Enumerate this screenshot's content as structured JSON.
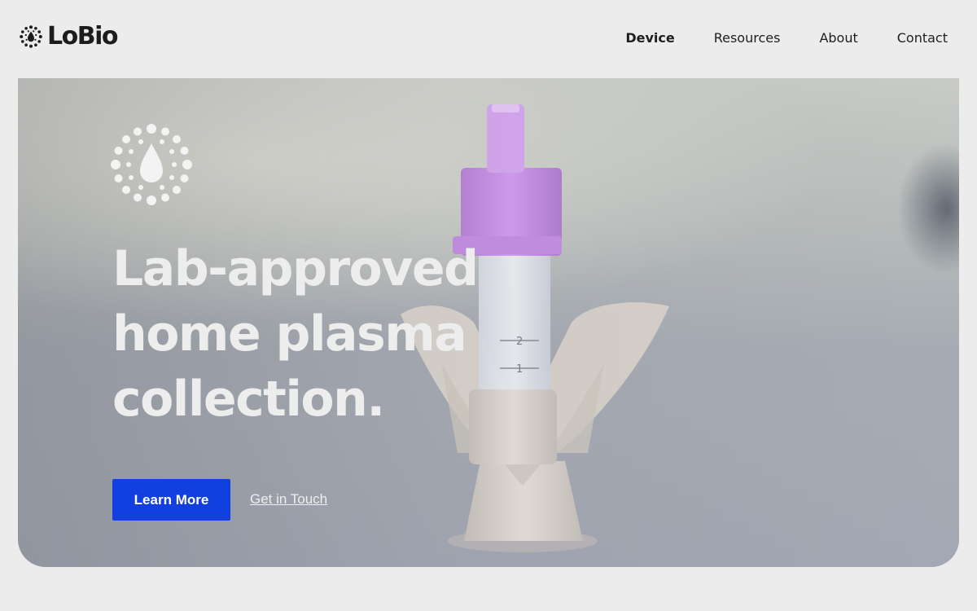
{
  "header": {
    "brand": "LoBio",
    "nav": [
      {
        "label": "Device",
        "active": true
      },
      {
        "label": "Resources",
        "active": false
      },
      {
        "label": "About",
        "active": false
      },
      {
        "label": "Contact",
        "active": false
      }
    ]
  },
  "hero": {
    "headline": [
      "Lab-approved",
      "home plasma",
      "collection."
    ],
    "primary_cta": "Learn More",
    "secondary_cta": "Get in Touch",
    "logo_icon": "dotted-ring-drop-icon",
    "image": "plasma-collection-device-with-purple-cap-tube",
    "tube_markings": [
      "2",
      "1"
    ]
  },
  "colors": {
    "background": "#ececec",
    "accent": "#1240e0",
    "headline": "#ededed",
    "cap": "#c58be0"
  }
}
